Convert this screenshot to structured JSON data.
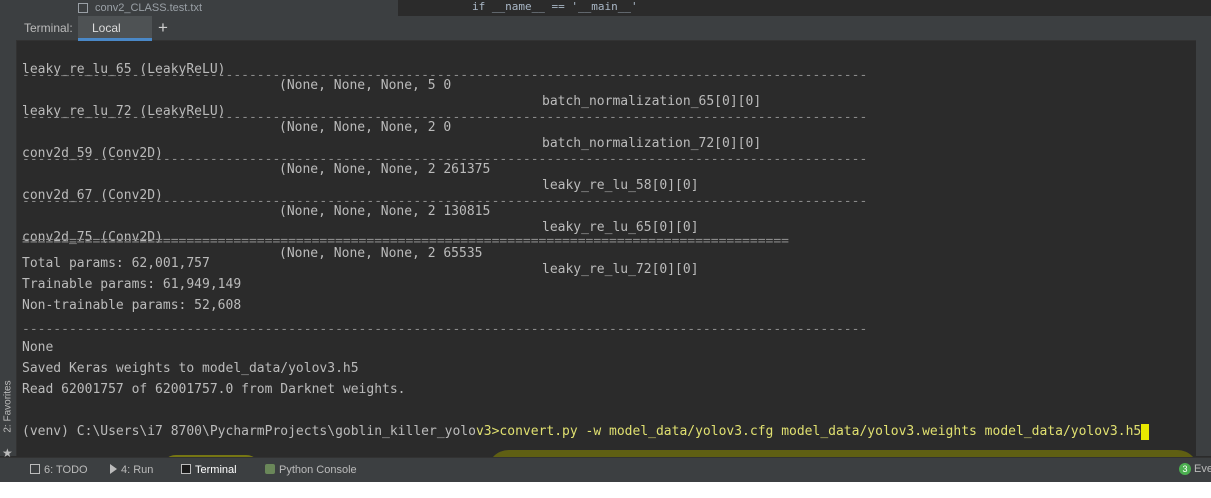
{
  "top": {
    "project_file": "conv2_CLASS.test.txt",
    "code_line": "if __name__ == '__main__'"
  },
  "sidebar": {
    "favorites": "2: Favorites"
  },
  "terminal": {
    "title": "Terminal:",
    "tab_label": "Local",
    "plus": "+",
    "rows": [
      {
        "name": "leaky_re_lu_65 (LeakyReLU)",
        "shape": "(None, None, None, 5 0",
        "conn": "batch_normalization_65[0][0]"
      },
      {
        "name": "leaky_re_lu_72 (LeakyReLU)",
        "shape": "(None, None, None, 2 0",
        "conn": "batch_normalization_72[0][0]"
      },
      {
        "name": "conv2d_59 (Conv2D)",
        "shape": "(None, None, None, 2 261375",
        "conn": "leaky_re_lu_58[0][0]"
      },
      {
        "name": "conv2d_67 (Conv2D)",
        "shape": "(None, None, None, 2 130815",
        "conn": "leaky_re_lu_65[0][0]"
      },
      {
        "name": "conv2d_75 (Conv2D)",
        "shape": "(None, None, None, 2 65535",
        "conn": "leaky_re_lu_72[0][0]"
      }
    ],
    "dash_sep": "------------------------------------------------------------------------------------------------------------",
    "eq_sep": "==================================================================================================",
    "total_params": "Total params: 62,001,757",
    "trainable_params": "Trainable params: 61,949,149",
    "non_trainable_params": "Non-trainable params: 52,608",
    "none_line": "None",
    "saved_line": "Saved Keras weights to model_data/yolov3.h5",
    "read_line": "Read 62001757 of 62001757.0 from Darknet weights.",
    "prompt": "(venv) C:\\Users\\i7 8700\\PycharmProjects\\goblin_killer_yolo",
    "command": "v3>convert.py -w model_data/yolov3.cfg model_data/yolov3.weights model_data/yolov3.h5"
  },
  "bottom_bar": {
    "todo": "6: TODO",
    "run": "4: Run",
    "terminal": "Terminal",
    "python_console": "Python Console",
    "event_count": "3",
    "event_label": "Eve"
  }
}
